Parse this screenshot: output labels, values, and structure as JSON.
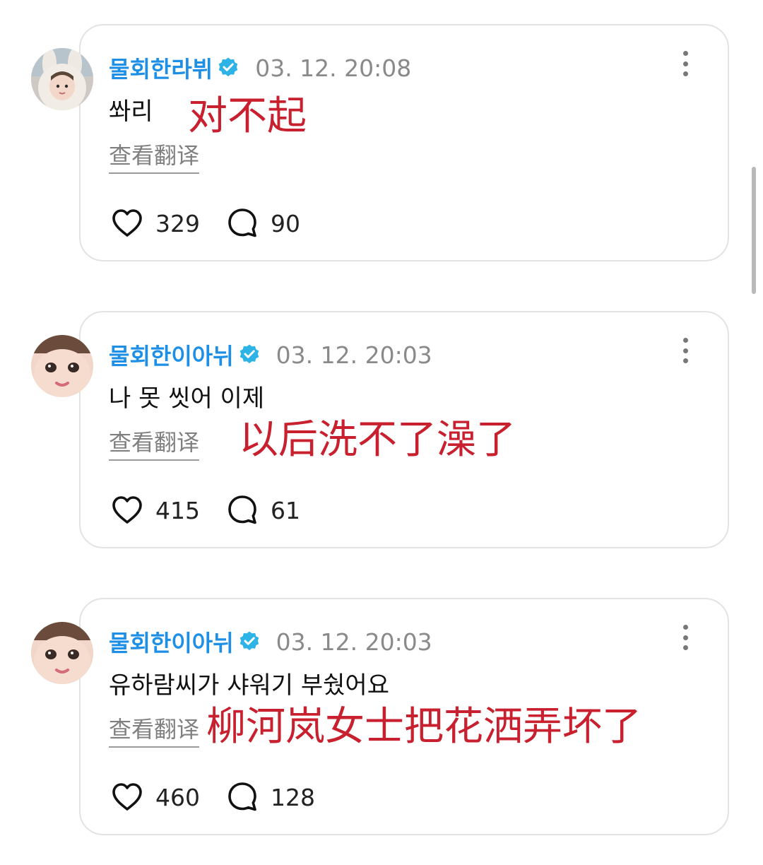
{
  "comments": [
    {
      "username": "물회한라뷔",
      "timestamp": "03. 12. 20:08",
      "text": "쏴리",
      "translation_note": "对不起",
      "translate_label": "查看翻译",
      "likes": "329",
      "replies": "90"
    },
    {
      "username": "물회한이아뉘",
      "timestamp": "03. 12. 20:03",
      "text": "나 못 씻어 이제",
      "translation_note": "以后洗不了澡了",
      "translate_label": "查看翻译",
      "likes": "415",
      "replies": "61"
    },
    {
      "username": "물회한이아뉘",
      "timestamp": "03. 12. 20:03",
      "text": "유하람씨가 샤워기 부쉈어요",
      "translation_note": "柳河岚女士把花洒弄坏了",
      "translate_label": "查看翻译",
      "likes": "460",
      "replies": "128"
    }
  ],
  "colors": {
    "username": "#1e8fe6",
    "verified_badge": "#2db3e6",
    "annotation": "#c8202e",
    "timestamp": "#8a8a8a"
  },
  "icons": {
    "verified": "verified-badge-icon",
    "more": "more-vertical-icon",
    "like": "heart-outline-icon",
    "reply": "speech-bubble-icon"
  }
}
